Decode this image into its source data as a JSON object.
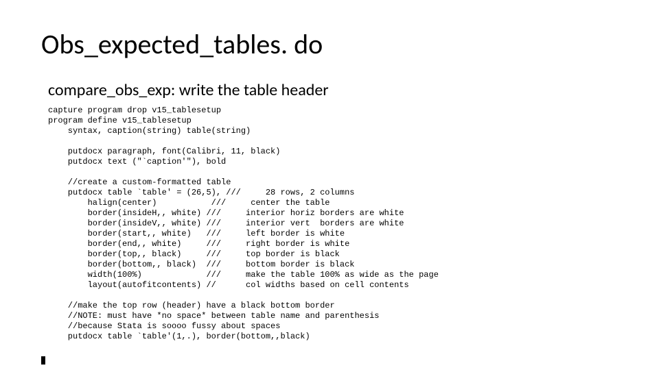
{
  "title": "Obs_expected_tables. do",
  "subtitle": "compare_obs_exp: write the table header",
  "code": "capture program drop v15_tablesetup\nprogram define v15_tablesetup\n    syntax, caption(string) table(string)\n\n    putdocx paragraph, font(Calibri, 11, black)\n    putdocx text (\"`caption'\"), bold\n\n    //create a custom-formatted table\n    putdocx table `table' = (26,5), ///     28 rows, 2 columns\n        halign(center)           ///     center the table\n        border(insideH,, white) ///     interior horiz borders are white\n        border(insideV,, white) ///     interior vert  borders are white\n        border(start,, white)   ///     left border is white\n        border(end,, white)     ///     right border is white\n        border(top,, black)     ///     top border is black\n        border(bottom,, black)  ///     bottom border is black\n        width(100%)             ///     make the table 100% as wide as the page\n        layout(autofitcontents) //      col widths based on cell contents\n\n    //make the top row (header) have a black bottom border\n    //NOTE: must have *no space* between table name and parenthesis\n    //because Stata is soooo fussy about spaces\n    putdocx table `table'(1,.), border(bottom,,black)"
}
